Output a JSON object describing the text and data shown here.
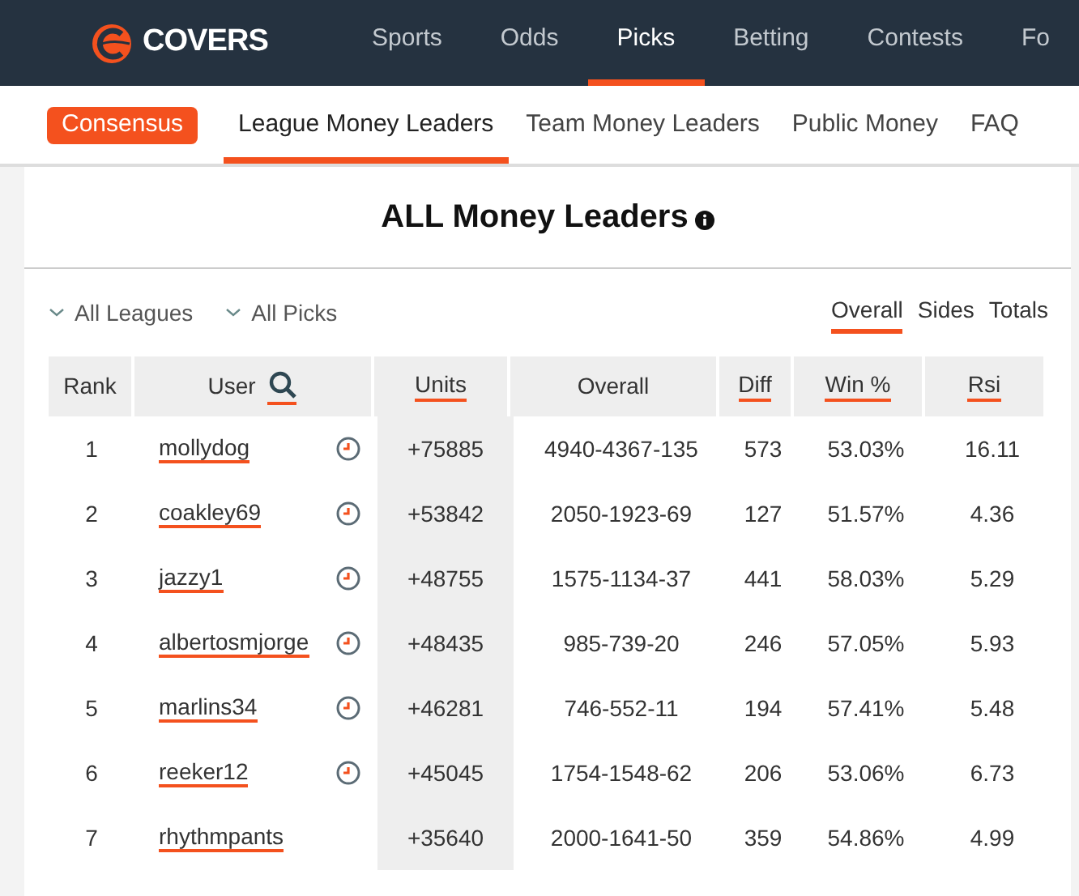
{
  "brand": {
    "name": "COVERS"
  },
  "nav": [
    {
      "label": "Sports",
      "selected": false
    },
    {
      "label": "Odds",
      "selected": false
    },
    {
      "label": "Picks",
      "selected": true
    },
    {
      "label": "Betting",
      "selected": false
    },
    {
      "label": "Contests",
      "selected": false
    },
    {
      "label": "Fo",
      "selected": false
    }
  ],
  "subnav": [
    {
      "label": "Consensus",
      "kind": "pill",
      "selected": false
    },
    {
      "label": "League Money Leaders",
      "kind": "tab",
      "selected": true
    },
    {
      "label": "Team Money Leaders",
      "kind": "tab",
      "selected": false
    },
    {
      "label": "Public Money",
      "kind": "tab",
      "selected": false
    },
    {
      "label": "FAQ",
      "kind": "tab",
      "selected": false
    }
  ],
  "title": "ALL Money Leaders",
  "filters": [
    {
      "label": "All Leagues"
    },
    {
      "label": "All Picks"
    }
  ],
  "views": [
    {
      "label": "Overall",
      "selected": true
    },
    {
      "label": "Sides",
      "selected": false
    },
    {
      "label": "Totals",
      "selected": false
    }
  ],
  "table": {
    "columns": [
      {
        "label": "Rank",
        "sortable": false,
        "search": false
      },
      {
        "label": "User",
        "sortable": false,
        "search": true
      },
      {
        "label": "Units",
        "sortable": true,
        "search": false
      },
      {
        "label": "Overall",
        "sortable": false,
        "search": false
      },
      {
        "label": "Diff",
        "sortable": true,
        "search": false
      },
      {
        "label": "Win %",
        "sortable": true,
        "search": false
      },
      {
        "label": "Rsi",
        "sortable": true,
        "search": false
      }
    ],
    "rows": [
      {
        "rank": "1",
        "user": "mollydog",
        "pending": true,
        "units": "+75885",
        "overall": "4940-4367-135",
        "diff": "573",
        "win": "53.03%",
        "rsi": "16.11"
      },
      {
        "rank": "2",
        "user": "coakley69",
        "pending": true,
        "units": "+53842",
        "overall": "2050-1923-69",
        "diff": "127",
        "win": "51.57%",
        "rsi": "4.36"
      },
      {
        "rank": "3",
        "user": "jazzy1",
        "pending": true,
        "units": "+48755",
        "overall": "1575-1134-37",
        "diff": "441",
        "win": "58.03%",
        "rsi": "5.29"
      },
      {
        "rank": "4",
        "user": "albertosmjorge",
        "pending": true,
        "units": "+48435",
        "overall": "985-739-20",
        "diff": "246",
        "win": "57.05%",
        "rsi": "5.93"
      },
      {
        "rank": "5",
        "user": "marlins34",
        "pending": true,
        "units": "+46281",
        "overall": "746-552-11",
        "diff": "194",
        "win": "57.41%",
        "rsi": "5.48"
      },
      {
        "rank": "6",
        "user": "reeker12",
        "pending": true,
        "units": "+45045",
        "overall": "1754-1548-62",
        "diff": "206",
        "win": "53.06%",
        "rsi": "6.73"
      },
      {
        "rank": "7",
        "user": "rhythmpants",
        "pending": false,
        "units": "+35640",
        "overall": "2000-1641-50",
        "diff": "359",
        "win": "54.86%",
        "rsi": "4.99"
      }
    ]
  }
}
